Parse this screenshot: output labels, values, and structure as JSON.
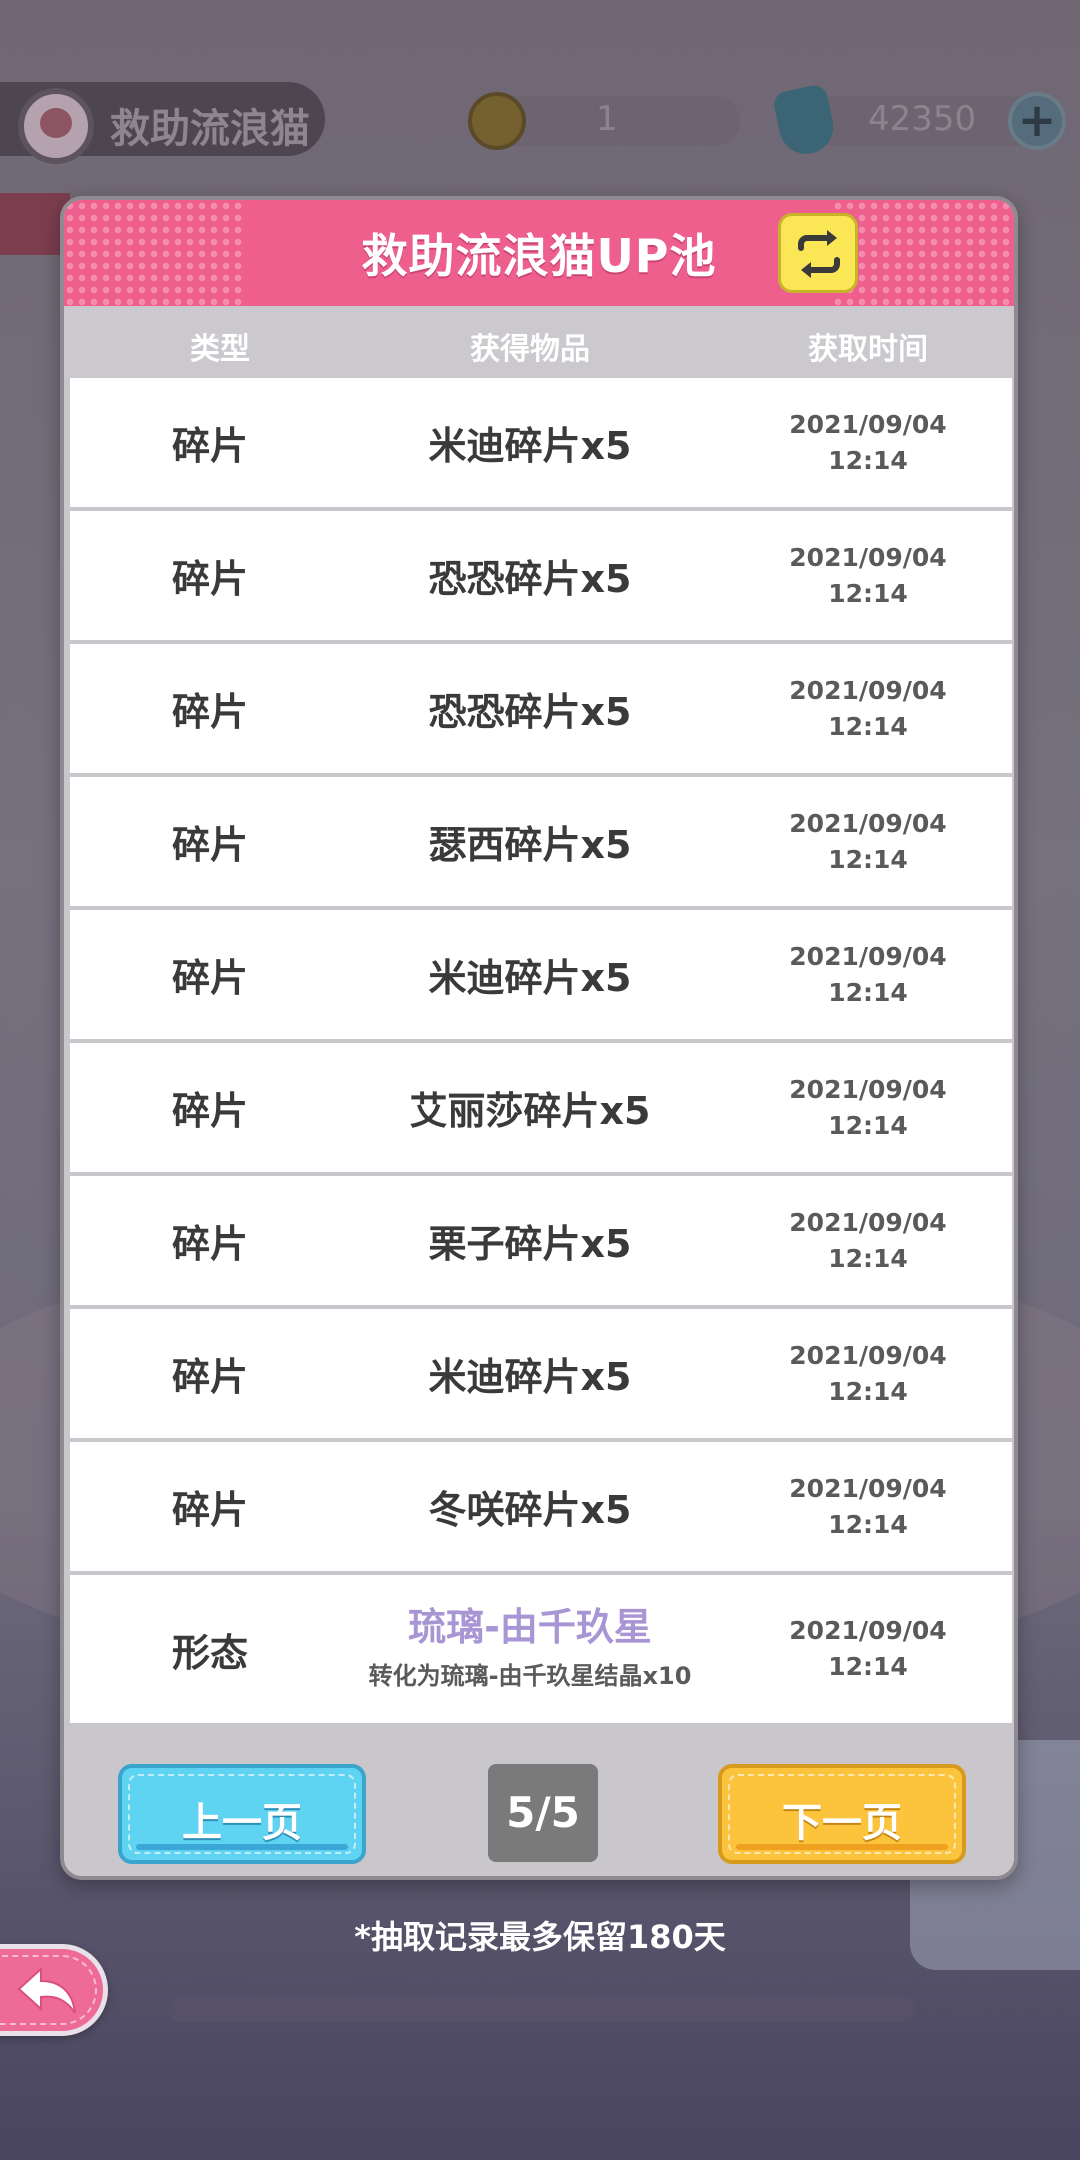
{
  "background": {
    "event_label": "救助流浪猫",
    "coin_value": "1",
    "gem_value": "42350"
  },
  "dialog": {
    "title": "救助流浪猫UP池",
    "switch_icon": "swap-arrows-icon",
    "columns": {
      "type": "类型",
      "item": "获得物品",
      "time": "获取时间"
    },
    "rows": [
      {
        "type": "碎片",
        "item": "米迪碎片x5",
        "date": "2021/09/04",
        "time": "12:14"
      },
      {
        "type": "碎片",
        "item": "恐恐碎片x5",
        "date": "2021/09/04",
        "time": "12:14"
      },
      {
        "type": "碎片",
        "item": "恐恐碎片x5",
        "date": "2021/09/04",
        "time": "12:14"
      },
      {
        "type": "碎片",
        "item": "瑟西碎片x5",
        "date": "2021/09/04",
        "time": "12:14"
      },
      {
        "type": "碎片",
        "item": "米迪碎片x5",
        "date": "2021/09/04",
        "time": "12:14"
      },
      {
        "type": "碎片",
        "item": "艾丽莎碎片x5",
        "date": "2021/09/04",
        "time": "12:14"
      },
      {
        "type": "碎片",
        "item": "栗子碎片x5",
        "date": "2021/09/04",
        "time": "12:14"
      },
      {
        "type": "碎片",
        "item": "米迪碎片x5",
        "date": "2021/09/04",
        "time": "12:14"
      },
      {
        "type": "碎片",
        "item": "冬咲碎片x5",
        "date": "2021/09/04",
        "time": "12:14"
      }
    ],
    "last_row": {
      "type": "形态",
      "item": "琉璃-由千玖星",
      "item_note": "转化为琉璃-由千玖星结晶x10",
      "date": "2021/09/04",
      "time": "12:14"
    },
    "pagination": {
      "prev_label": "上一页",
      "next_label": "下一页",
      "page_indicator": "5/5"
    }
  },
  "note": "*抽取记录最多保留180天",
  "back_button_icon": "back-arrow-icon",
  "colors": {
    "header": "#ef5f8e",
    "switch": "#fbe755",
    "prev_button": "#5fd3f2",
    "next_button": "#fcc43c",
    "page_indicator": "#7a7a7a",
    "special_item": "#a895d3"
  }
}
